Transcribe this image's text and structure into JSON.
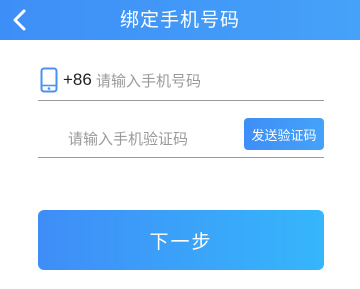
{
  "header": {
    "title": "绑定手机号码",
    "back_icon": "chevron-left-icon"
  },
  "phone": {
    "icon": "mobile-phone-icon",
    "country_code": "+86",
    "placeholder": "请输入手机号码",
    "value": ""
  },
  "verify": {
    "placeholder": "请输入手机验证码",
    "value": "",
    "send_label": "发送验证码"
  },
  "actions": {
    "next_label": "下一步"
  },
  "colors": {
    "primary": "#3e8ef7",
    "primary_light": "#36b6fb",
    "divider": "#9a9a9a",
    "placeholder": "#9a9a9a"
  }
}
